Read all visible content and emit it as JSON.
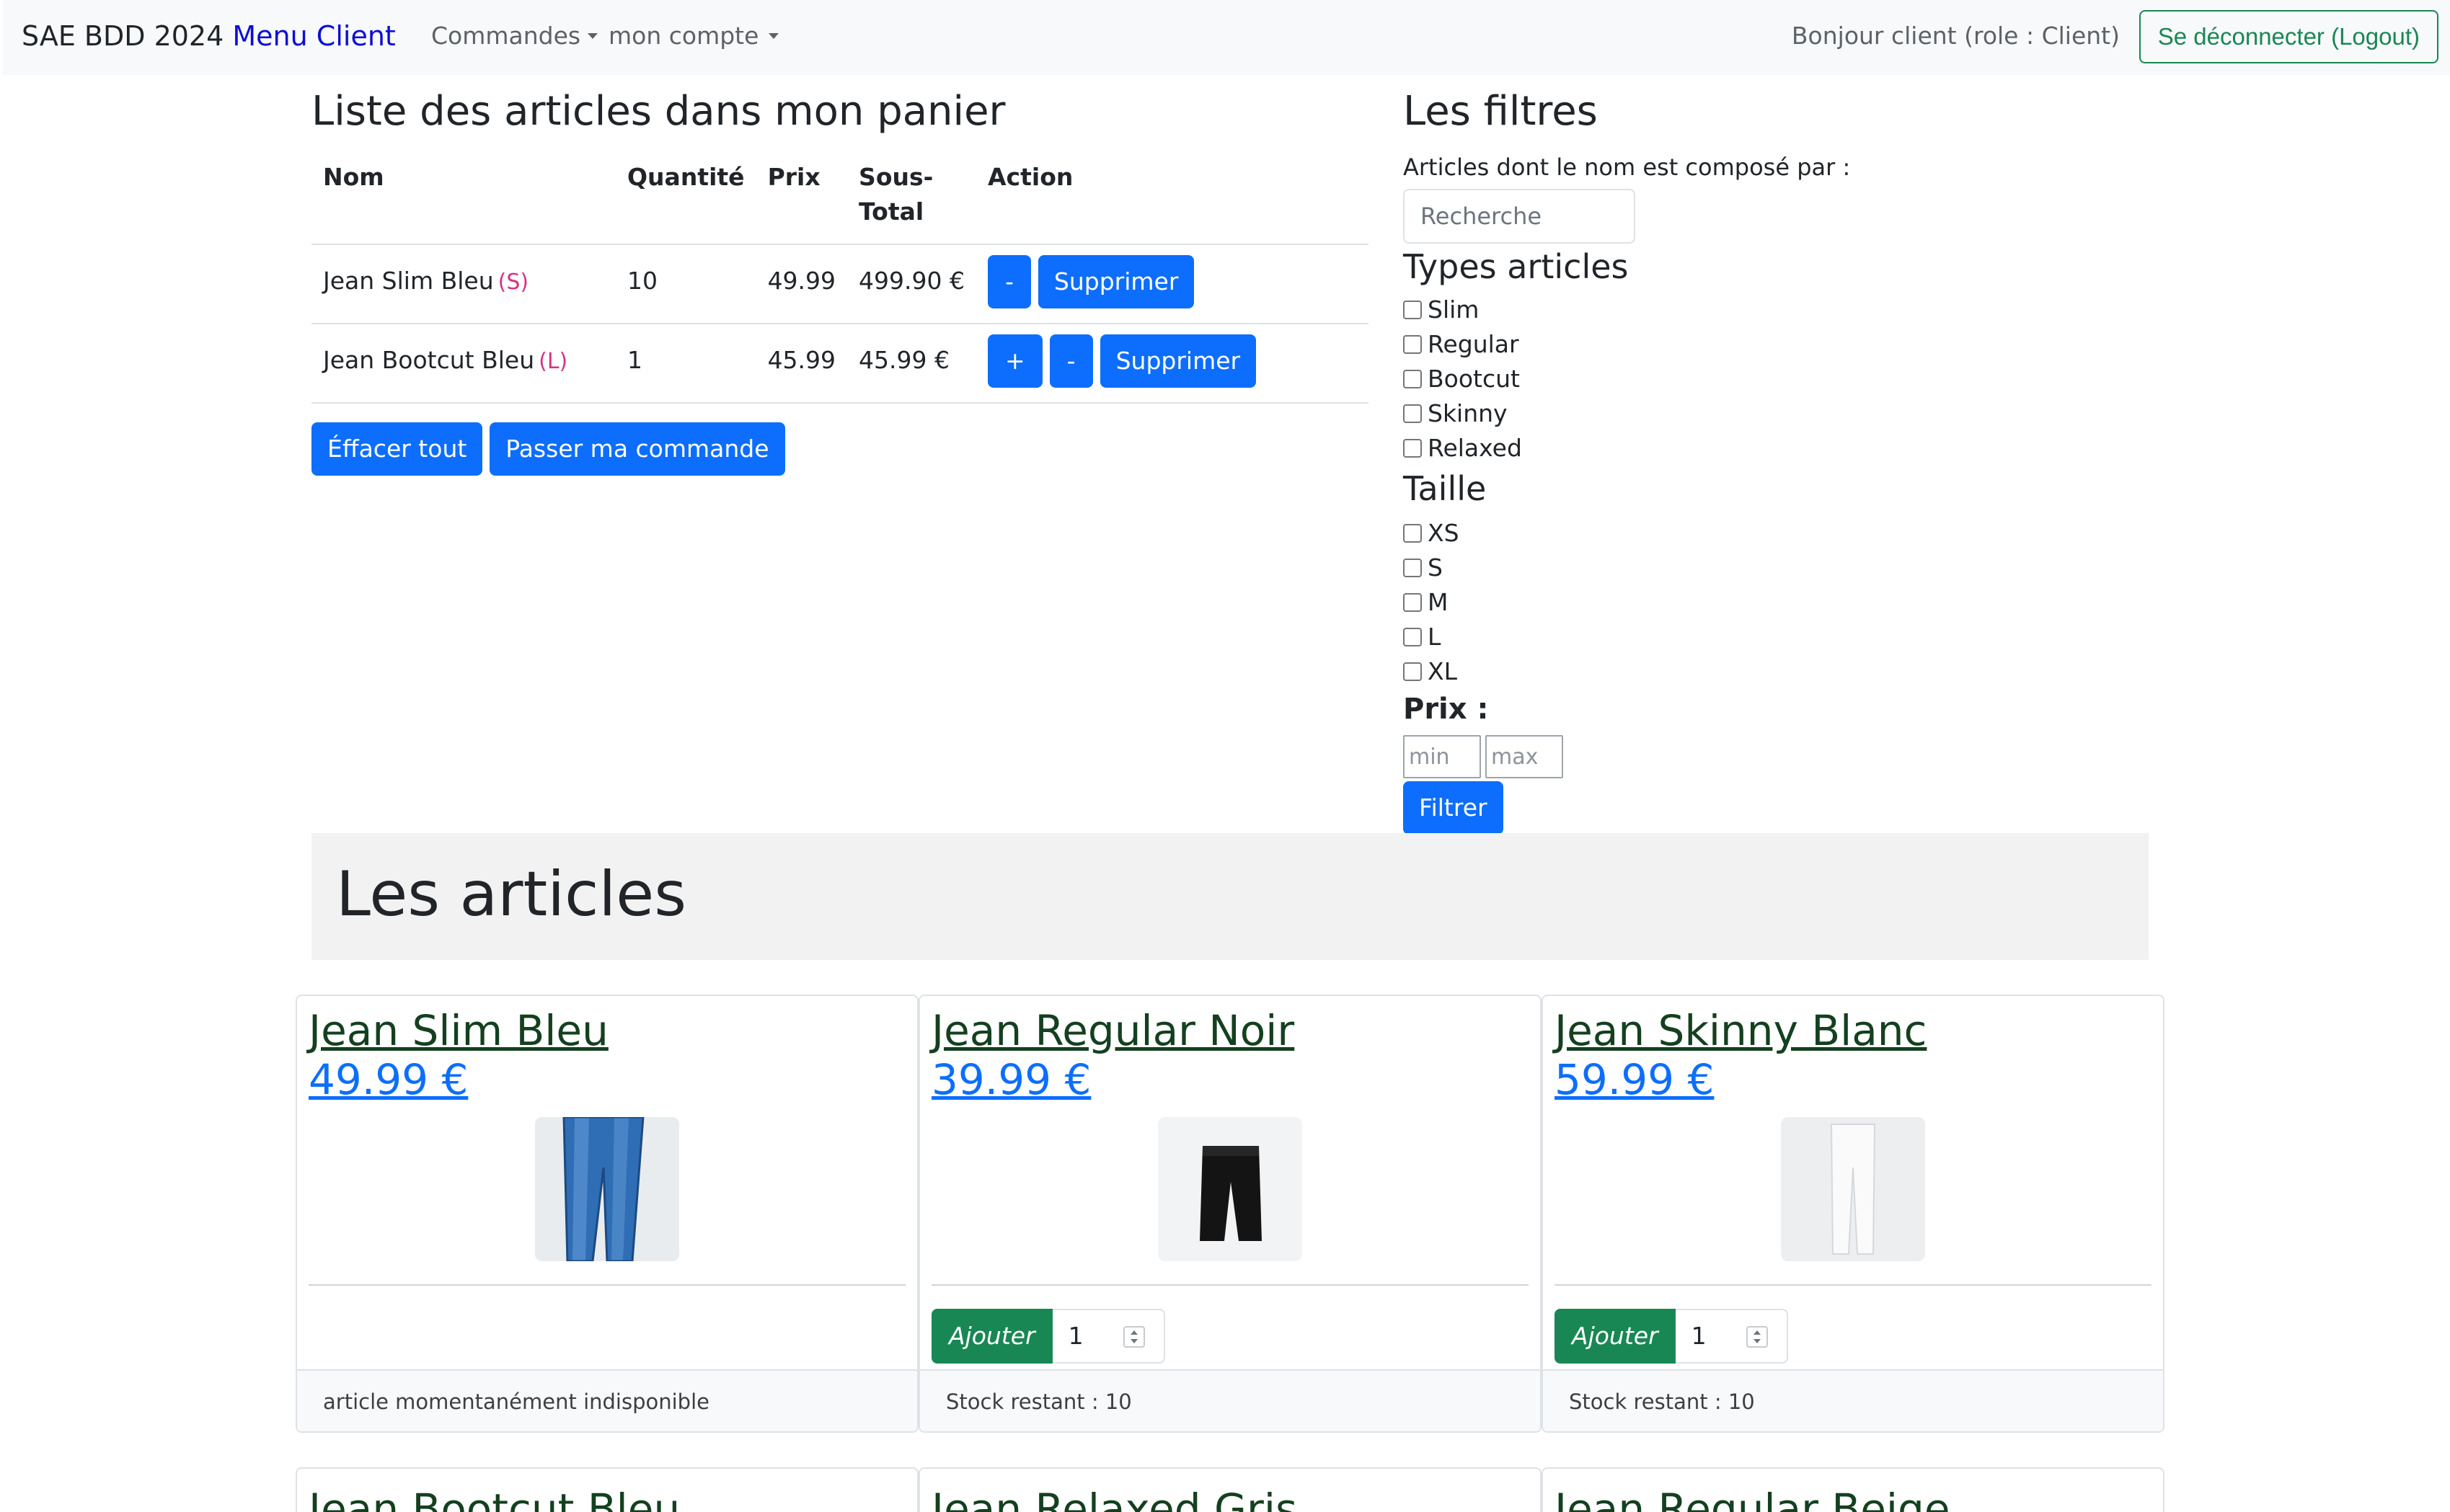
{
  "navbar": {
    "brand": "SAE BDD 2024",
    "menu": "Menu Client",
    "commandes": "Commandes",
    "mon_compte": "mon compte",
    "greeting": "Bonjour client (role : Client)",
    "logout": "Se déconnecter (Logout)"
  },
  "cart": {
    "title": "Liste des articles dans mon panier",
    "headers": [
      "Nom",
      "Quantité",
      "Prix",
      "Sous-Total",
      "Action"
    ],
    "rows": [
      {
        "name": "Jean Slim Bleu",
        "size": "(S)",
        "qty": "10",
        "price": "49.99",
        "subtotal": "499.90 €",
        "minus": "-",
        "delete": "Supprimer"
      },
      {
        "name": "Jean Bootcut Bleu",
        "size": "(L)",
        "qty": "1",
        "price": "45.99",
        "subtotal": "45.99 €",
        "plus": "+",
        "minus": "-",
        "delete": "Supprimer"
      }
    ],
    "clear_all": "Éffacer tout",
    "checkout": "Passer ma commande"
  },
  "filters": {
    "title": "Les filtres",
    "name_label": "Articles dont le nom est composé par :",
    "search_placeholder": "Recherche",
    "types_title": "Types articles",
    "types": [
      "Slim",
      "Regular",
      "Bootcut",
      "Skinny",
      "Relaxed"
    ],
    "size_title": "Taille",
    "sizes": [
      "XS",
      "S",
      "M",
      "L",
      "XL"
    ],
    "price_title": "Prix :",
    "min_placeholder": "min",
    "max_placeholder": "max",
    "filter_button": "Filtrer"
  },
  "articles": {
    "title": "Les articles",
    "cards": [
      {
        "name": "Jean Slim Bleu",
        "price": "49.99 €",
        "image": "blue-slim-jeans",
        "add": "",
        "qty": "",
        "footer": "article momentanément indisponible"
      },
      {
        "name": "Jean Regular Noir",
        "price": "39.99 €",
        "image": "black-regular-jeans",
        "add": "Ajouter",
        "qty": "1",
        "footer": "Stock restant : 10"
      },
      {
        "name": "Jean Skinny Blanc",
        "price": "59.99 €",
        "image": "white-skinny-jeans",
        "add": "Ajouter",
        "qty": "1",
        "footer": "Stock restant : 10"
      },
      {
        "name": "Jean Bootcut Bleu"
      },
      {
        "name": "Jean Relaxed Gris"
      },
      {
        "name": "Jean Regular Beige"
      }
    ]
  },
  "colors": {
    "primary": "#0d6efd",
    "success": "#198754",
    "navbar_bg": "#f8f9fa",
    "size_badge": "#d63384"
  }
}
